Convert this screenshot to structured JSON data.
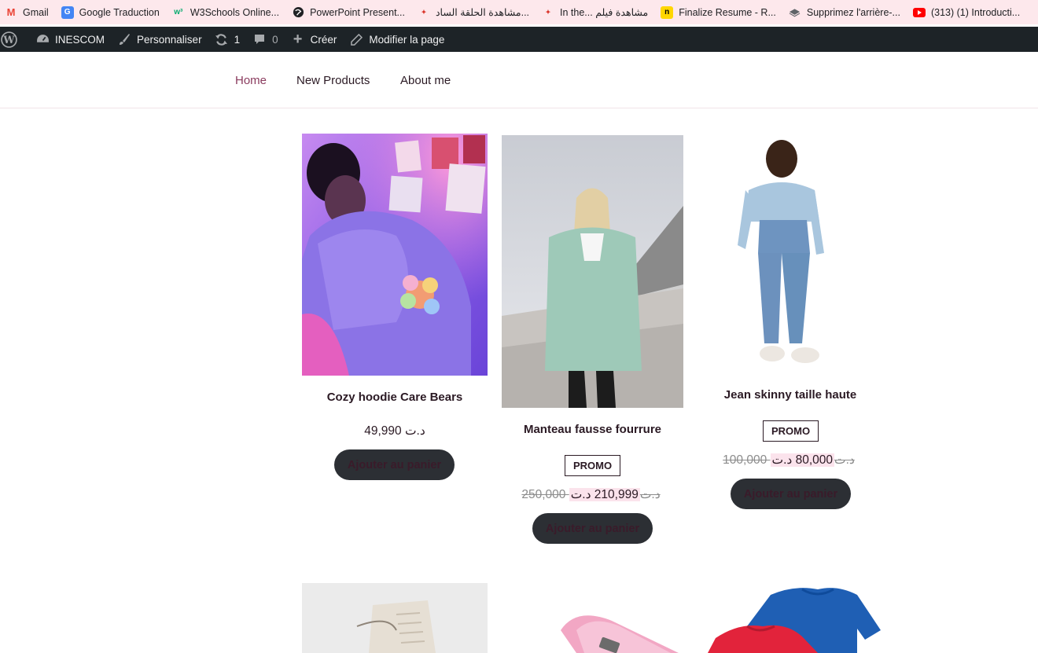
{
  "bookmarks": [
    {
      "label": "Gmail",
      "icon": "gmail-icon"
    },
    {
      "label": "Google Traduction",
      "icon": "google-translate-icon"
    },
    {
      "label": "W3Schools Online...",
      "icon": "w3schools-icon"
    },
    {
      "label": "PowerPoint Present...",
      "icon": "globe-icon"
    },
    {
      "label": "مشاهدة الحلقة الساد...",
      "icon": "site-icon"
    },
    {
      "label": "In the... مشاهدة فيلم",
      "icon": "site-icon"
    },
    {
      "label": "Finalize Resume - R...",
      "icon": "resume-icon"
    },
    {
      "label": "Supprimez l'arrière-...",
      "icon": "layers-icon"
    },
    {
      "label": "(313) (1) Introducti...",
      "icon": "youtube-icon"
    }
  ],
  "adminbar": {
    "site_name": "INESCOM",
    "customize": "Personnaliser",
    "updates_count": "1",
    "comments_count": "0",
    "create": "Créer",
    "edit_page": "Modifier la page"
  },
  "nav": {
    "home": "Home",
    "new_products": "New Products",
    "about": "About me"
  },
  "products": [
    {
      "title": "Cozy hoodie Care Bears",
      "price": "49,990 د.ت",
      "button": "Ajouter au panier"
    },
    {
      "title": "Manteau fausse fourrure",
      "promo": "PROMO",
      "old_price": "250,000 د.ت",
      "new_price": "210,999 د.ت",
      "button": "Ajouter au panier"
    },
    {
      "title": "Jean skinny taille haute",
      "promo": "PROMO",
      "old_price": "100,000 د.ت",
      "new_price": "80,000 د.ت",
      "button": "Ajouter au panier"
    }
  ],
  "colors": {
    "bookmark_bar": "#fde8ec",
    "admin_bar": "#1d2327",
    "nav_active": "#8a3b5e",
    "button_bg": "#2c2f34",
    "sale_highlight": "#fbe3ec"
  }
}
